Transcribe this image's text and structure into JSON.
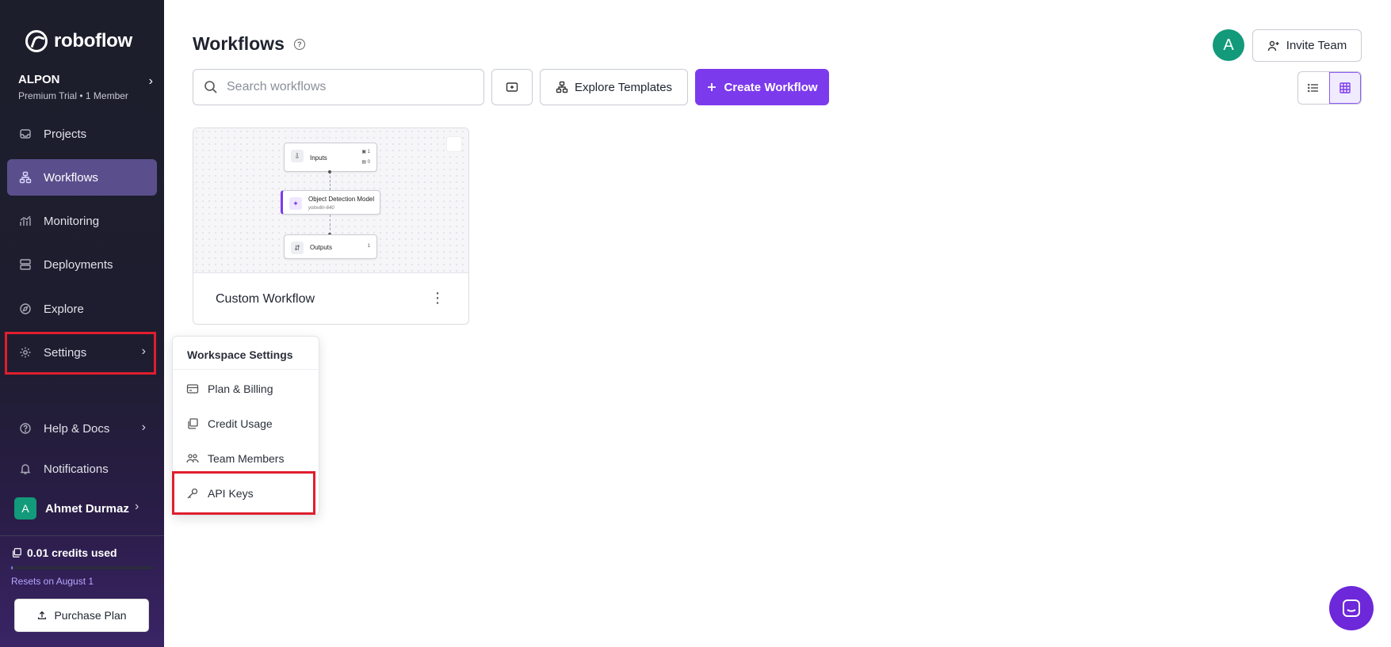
{
  "brand": {
    "name": "roboflow"
  },
  "workspace": {
    "name": "ALPON",
    "plan": "Premium Trial",
    "members": "1 Member"
  },
  "nav": {
    "projects": "Projects",
    "workflows": "Workflows",
    "monitoring": "Monitoring",
    "deployments": "Deployments",
    "explore": "Explore",
    "settings": "Settings",
    "help": "Help & Docs",
    "notifications": "Notifications"
  },
  "user": {
    "initial": "A",
    "name": "Ahmet Durmaz"
  },
  "credits": {
    "used": "0.01 credits used",
    "resets": "Resets on August 1",
    "purchase": "Purchase Plan",
    "progress_fraction": 0.01
  },
  "header": {
    "title": "Workflows",
    "invite": "Invite Team",
    "avatar_initial": "A"
  },
  "toolbar": {
    "search_placeholder": "Search workflows",
    "explore_templates": "Explore Templates",
    "create_workflow": "Create Workflow"
  },
  "card": {
    "title": "Custom Workflow",
    "nodes": {
      "inputs": {
        "label": "Inputs",
        "count_image": "1",
        "count_param": "0"
      },
      "detection": {
        "label": "Object Detection Model",
        "model": "yolov8n-640"
      },
      "outputs": {
        "label": "Outputs",
        "count": "1"
      }
    }
  },
  "settings_menu": {
    "header": "Workspace Settings",
    "items": [
      "Plan & Billing",
      "Credit Usage",
      "Team Members",
      "API Keys"
    ]
  },
  "colors": {
    "accent": "#7c3aed",
    "highlight": "#e01e2d",
    "avatar": "#129a7a",
    "sidebar_active": "#5a4f8c"
  }
}
